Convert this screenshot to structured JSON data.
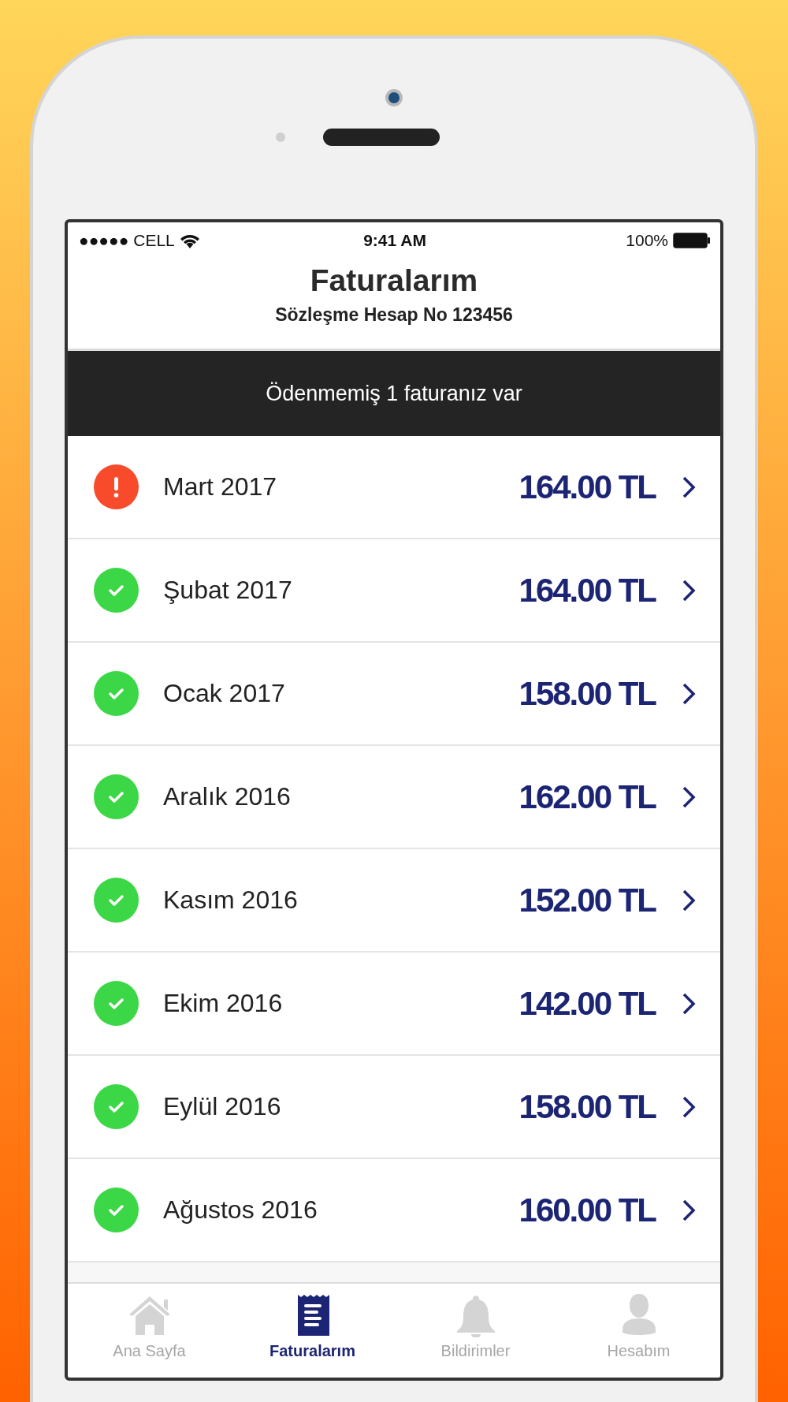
{
  "status_bar": {
    "carrier": "●●●●● CELL",
    "time": "9:41 AM",
    "battery": "100%"
  },
  "header": {
    "title": "Faturalarım",
    "subtitle": "Sözleşme Hesap No 123456"
  },
  "banner": "Ödenmemiş 1 faturanız var",
  "invoices": [
    {
      "kind": "unpaid",
      "month": "Mart 2017",
      "amount": "164.00 TL"
    },
    {
      "kind": "paid",
      "month": "Şubat 2017",
      "amount": "164.00 TL"
    },
    {
      "kind": "paid",
      "month": "Ocak 2017",
      "amount": "158.00 TL"
    },
    {
      "kind": "paid",
      "month": "Aralık 2016",
      "amount": "162.00 TL"
    },
    {
      "kind": "paid",
      "month": "Kasım 2016",
      "amount": "152.00 TL"
    },
    {
      "kind": "paid",
      "month": "Ekim 2016",
      "amount": "142.00 TL"
    },
    {
      "kind": "paid",
      "month": "Eylül 2016",
      "amount": "158.00 TL"
    },
    {
      "kind": "paid",
      "month": "Ağustos 2016",
      "amount": "160.00 TL"
    }
  ],
  "tab_bar": [
    {
      "kind": "home",
      "label": "Ana Sayfa",
      "selected": false
    },
    {
      "kind": "invoice",
      "label": "Faturalarım",
      "selected": true
    },
    {
      "kind": "bell",
      "label": "Bildirimler",
      "selected": false
    },
    {
      "kind": "person",
      "label": "Hesabım",
      "selected": false
    }
  ]
}
